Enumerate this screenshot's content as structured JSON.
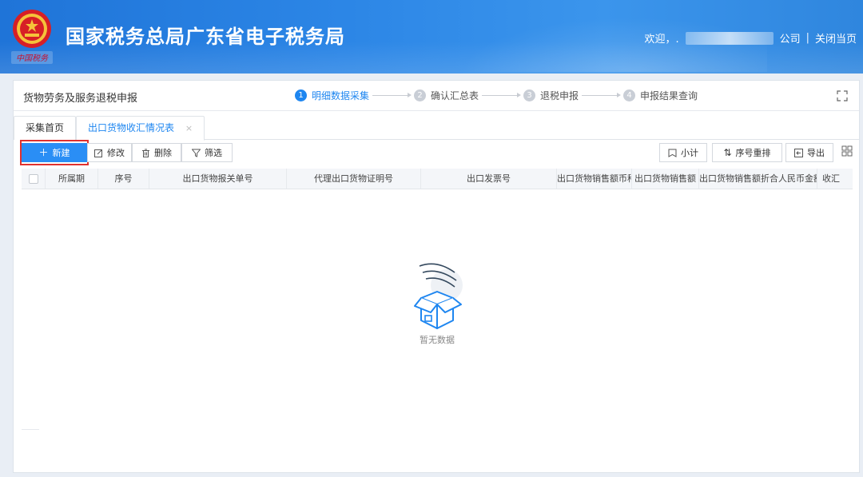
{
  "header": {
    "title": "国家税务总局广东省电子税务局",
    "emblem_caption": "中国税务",
    "welcome": "欢迎，.",
    "company_suffix": "公司",
    "close_label": "关闭当页"
  },
  "page": {
    "title": "货物劳务及服务退税申报"
  },
  "steps": [
    {
      "num": "1",
      "label": "明细数据采集",
      "active": true
    },
    {
      "num": "2",
      "label": "确认汇总表",
      "active": false
    },
    {
      "num": "3",
      "label": "退税申报",
      "active": false
    },
    {
      "num": "4",
      "label": "申报结果查询",
      "active": false
    }
  ],
  "tabs": [
    {
      "label": "采集首页"
    },
    {
      "label": "出口货物收汇情况表",
      "close": "×"
    }
  ],
  "toolbar": {
    "new_label": "新建",
    "edit_label": "修改",
    "delete_label": "删除",
    "filter_label": "筛选",
    "subtotal_label": "小计",
    "renumber_label": "序号重排",
    "export_label": "导出"
  },
  "table": {
    "columns": [
      "所属期",
      "序号",
      "出口货物报关单号",
      "代理出口货物证明号",
      "出口发票号",
      "出口货物销售额币种",
      "出口货物销售额",
      "出口货物销售额折合人民币金额",
      "收汇"
    ]
  },
  "empty": {
    "text": "暂无数据"
  },
  "colors": {
    "header_blue": "#2c86e6",
    "accent": "#1e86f0",
    "primary_button": "#2a8ef5",
    "highlight_red": "#e0312f"
  }
}
